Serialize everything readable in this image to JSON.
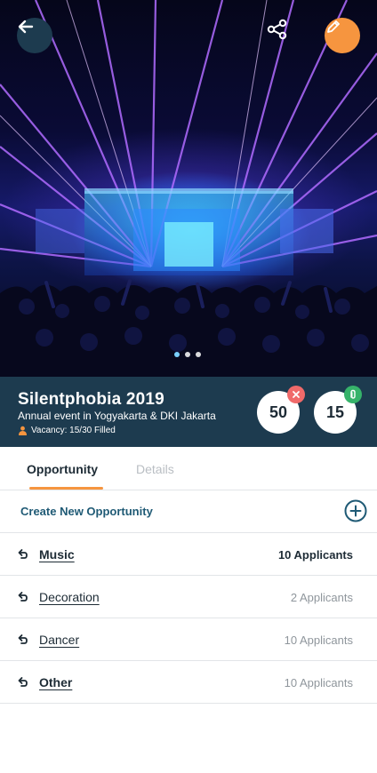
{
  "header": {
    "back_icon": "arrow-left-icon",
    "share_icon": "share-icon",
    "edit_icon": "pencil-icon",
    "carousel": {
      "count": 3,
      "active": 0
    }
  },
  "event": {
    "title": "Silentphobia 2019",
    "subtitle": "Annual event in Yogyakarta & DKI Jakarta",
    "vacancy": "Vacancy: 15/30 Filled",
    "stats": {
      "rejected": "50",
      "accepted": "15"
    }
  },
  "tabs": {
    "opportunity": "Opportunity",
    "details": "Details"
  },
  "create": {
    "label": "Create New Opportunity"
  },
  "opportunities": [
    {
      "name": "Music",
      "applicants": "10 Applicants",
      "highlight": true
    },
    {
      "name": "Decoration",
      "applicants": "2 Applicants",
      "highlight": false
    },
    {
      "name": "Dancer",
      "applicants": "10 Applicants",
      "highlight": false
    },
    {
      "name": "Other",
      "applicants": "10 Applicants",
      "highlight": true
    }
  ],
  "colors": {
    "primary": "#1d3b4f",
    "accent": "#f6953f",
    "link": "#1f5a75",
    "reject": "#f06a6a",
    "accept": "#36b36a"
  }
}
